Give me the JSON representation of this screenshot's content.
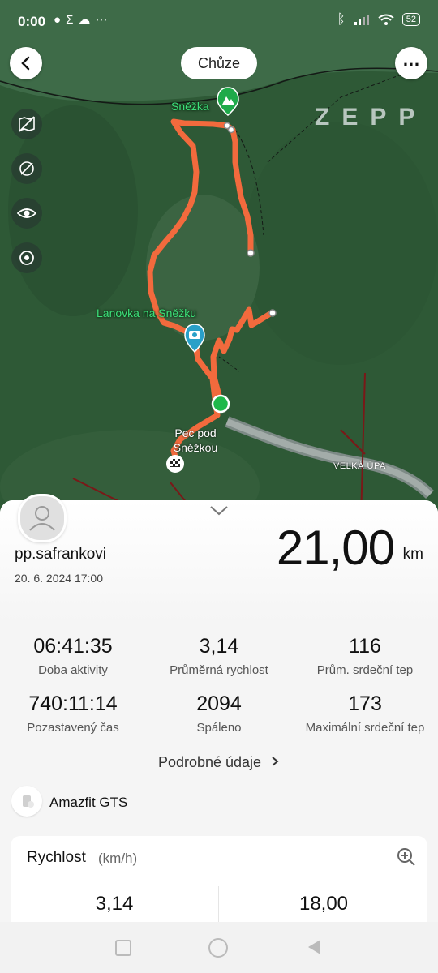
{
  "status_bar": {
    "time": "0:00",
    "battery": "52"
  },
  "header": {
    "activity_type": "Chůze"
  },
  "brand": {
    "watermark": "ZEPP"
  },
  "map": {
    "labels": {
      "peak": "Sněžka",
      "cable_car": "Lanovka na Sněžku",
      "start_place": "Pec pod Sněžkou",
      "valley": "VELKÁ ÚPA"
    },
    "route_color": "#f26a3d",
    "start_color": "#1fb84a"
  },
  "summary": {
    "username": "pp.safrankovi",
    "date": "20. 6. 2024 17:00",
    "distance": "21,00",
    "distance_unit": "km"
  },
  "stats": [
    {
      "value": "06:41:35",
      "label": "Doba aktivity"
    },
    {
      "value": "3,14",
      "label": "Průměrná rychlost"
    },
    {
      "value": "116",
      "label": "Prům. srdeční tep"
    },
    {
      "value": "740:11:14",
      "label": "Pozastavený čas"
    },
    {
      "value": "2094",
      "label": "Spáleno"
    },
    {
      "value": "173",
      "label": "Maximální srdeční tep"
    }
  ],
  "details_link": "Podrobné údaje",
  "device": "Amazfit GTS",
  "speed_card": {
    "title": "Rychlost",
    "unit": "(km/h)",
    "avg": "3,14",
    "max": "18,00"
  }
}
